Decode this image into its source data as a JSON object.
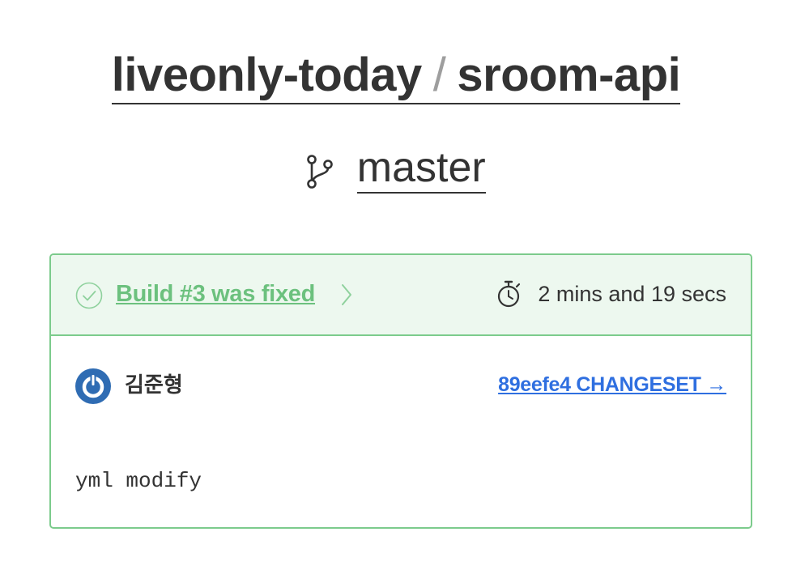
{
  "repo": {
    "owner": "liveonly-today",
    "separator": "/",
    "name": "sroom-api"
  },
  "branch": {
    "name": "master",
    "icon": "git-branch-icon"
  },
  "build": {
    "status_text": "Build #3 was fixed",
    "status_icon": "check-circle-icon",
    "status_color": "#6cc17e",
    "duration": "2 mins and 19 secs",
    "duration_icon": "stopwatch-icon"
  },
  "commit": {
    "author": "김준형",
    "avatar_icon": "avatar",
    "changeset_label": "89eefe4 CHANGESET →",
    "message": "yml modify",
    "link_color": "#2f6fe0"
  },
  "colors": {
    "card_border": "#7ccb8c",
    "header_bg": "#edf8ef",
    "avatar_blue": "#2f6cb3"
  }
}
